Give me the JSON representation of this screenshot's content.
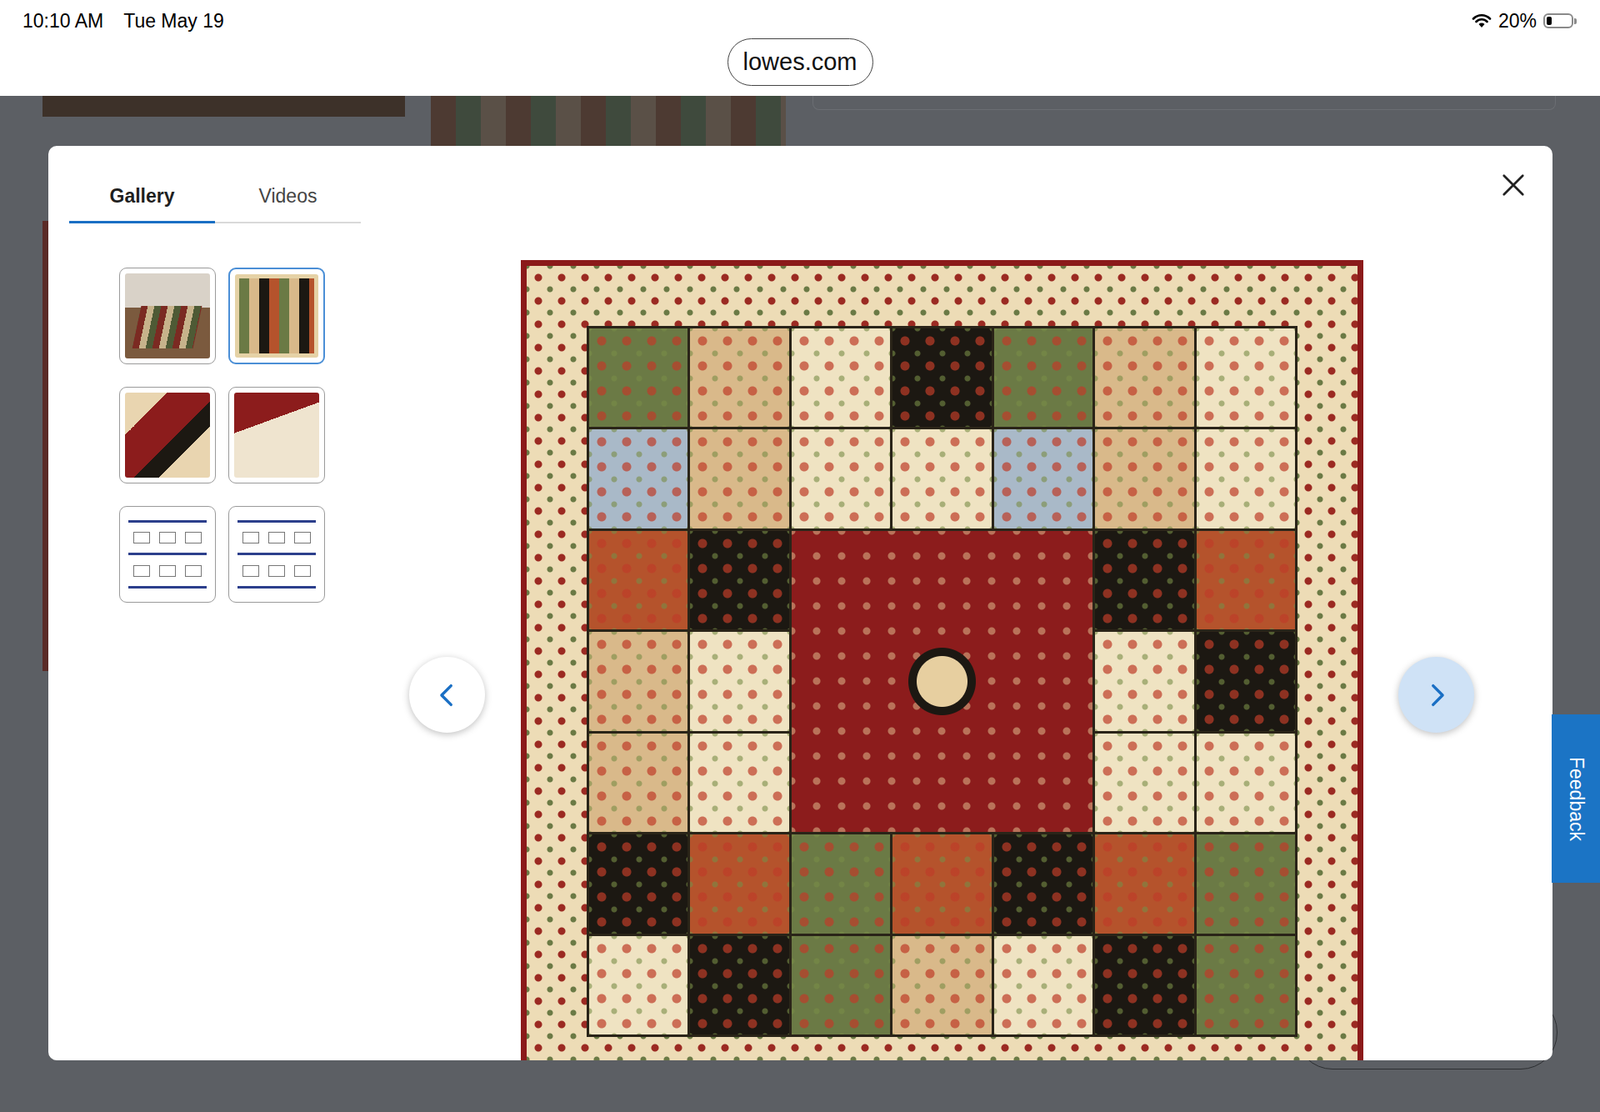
{
  "status_bar": {
    "time": "10:10 AM",
    "date": "Tue May 19",
    "battery": "20%",
    "battery_level": 0.2
  },
  "address_bar": {
    "url": "lowes.com"
  },
  "gallery": {
    "tabs": [
      {
        "label": "Gallery",
        "selected": true
      },
      {
        "label": "Videos",
        "selected": false
      }
    ],
    "thumbnails": [
      {
        "kind": "room",
        "selected": false
      },
      {
        "kind": "rug",
        "selected": true
      },
      {
        "kind": "closeup",
        "selected": false
      },
      {
        "kind": "back",
        "selected": false
      },
      {
        "kind": "sizes",
        "selected": false
      },
      {
        "kind": "sizes",
        "selected": false
      }
    ]
  },
  "feedback": {
    "label": "Feedback"
  }
}
